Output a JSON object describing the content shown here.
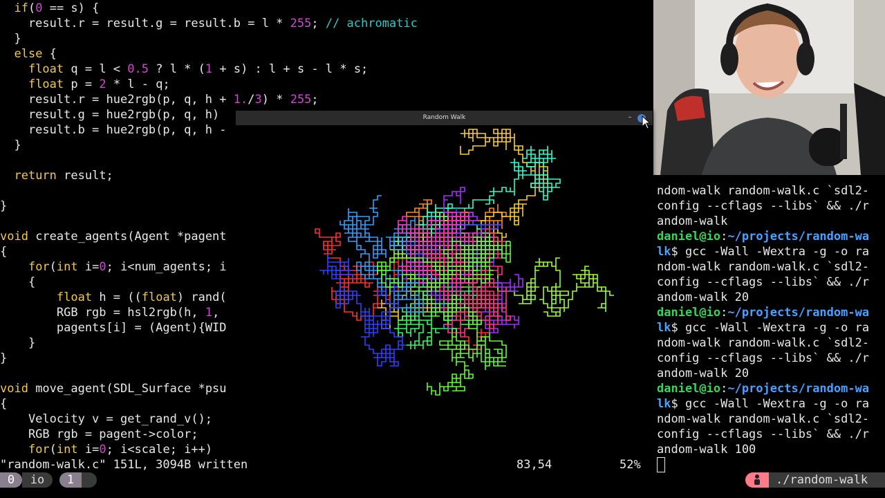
{
  "editor": {
    "lines": [
      [
        {
          "t": "  "
        },
        {
          "t": "if",
          "c": "kw"
        },
        {
          "t": "("
        },
        {
          "t": "0",
          "c": "num"
        },
        {
          "t": " == s) {"
        }
      ],
      [
        {
          "t": "    result.r = result.g = result.b = l * "
        },
        {
          "t": "255",
          "c": "num"
        },
        {
          "t": "; "
        },
        {
          "t": "// achromatic",
          "c": "cm"
        }
      ],
      [
        {
          "t": "  }"
        }
      ],
      [
        {
          "t": "  "
        },
        {
          "t": "else",
          "c": "kw"
        },
        {
          "t": " {"
        }
      ],
      [
        {
          "t": "    "
        },
        {
          "t": "float",
          "c": "kw"
        },
        {
          "t": " q = l < "
        },
        {
          "t": "0.5",
          "c": "num"
        },
        {
          "t": " ? l * ("
        },
        {
          "t": "1",
          "c": "num"
        },
        {
          "t": " + s) : l + s - l * s;"
        }
      ],
      [
        {
          "t": "    "
        },
        {
          "t": "float",
          "c": "kw"
        },
        {
          "t": " p = "
        },
        {
          "t": "2",
          "c": "num"
        },
        {
          "t": " * l - q;"
        }
      ],
      [
        {
          "t": "    result.r = hue2rgb(p, q, h + "
        },
        {
          "t": "1.",
          "c": "num"
        },
        {
          "t": "/"
        },
        {
          "t": "3",
          "c": "num"
        },
        {
          "t": ") * "
        },
        {
          "t": "255",
          "c": "num"
        },
        {
          "t": ";"
        }
      ],
      [
        {
          "t": "    result.g = hue2rgb(p, q, h) "
        }
      ],
      [
        {
          "t": "    result.b = hue2rgb(p, q, h -"
        }
      ],
      [
        {
          "t": "  }"
        }
      ],
      [
        {
          "t": ""
        }
      ],
      [
        {
          "t": "  "
        },
        {
          "t": "return",
          "c": "kw"
        },
        {
          "t": " result;"
        }
      ],
      [
        {
          "t": ""
        }
      ],
      [
        {
          "t": "}"
        }
      ],
      [
        {
          "t": ""
        }
      ],
      [
        {
          "t": "void",
          "c": "kw"
        },
        {
          "t": " create_agents(Agent *pagent"
        }
      ],
      [
        {
          "t": "{"
        }
      ],
      [
        {
          "t": "    "
        },
        {
          "t": "for",
          "c": "kw"
        },
        {
          "t": "("
        },
        {
          "t": "int",
          "c": "kw"
        },
        {
          "t": " i="
        },
        {
          "t": "0",
          "c": "num"
        },
        {
          "t": "; i<num_agents; i"
        }
      ],
      [
        {
          "t": "    {"
        }
      ],
      [
        {
          "t": "        "
        },
        {
          "t": "float",
          "c": "kw"
        },
        {
          "t": " h = (("
        },
        {
          "t": "float",
          "c": "kw"
        },
        {
          "t": ") rand("
        }
      ],
      [
        {
          "t": "        RGB rgb = hsl2rgb(h, "
        },
        {
          "t": "1",
          "c": "num"
        },
        {
          "t": ","
        }
      ],
      [
        {
          "t": "        pagents[i] = (Agent){WID"
        }
      ],
      [
        {
          "t": "    }"
        }
      ],
      [
        {
          "t": "}"
        }
      ],
      [
        {
          "t": ""
        }
      ],
      [
        {
          "t": "void",
          "c": "kw"
        },
        {
          "t": " move_agent(SDL_Surface *psu"
        }
      ],
      [
        {
          "t": "{"
        }
      ],
      [
        {
          "t": "    Velocity v = get_rand_v();"
        }
      ],
      [
        {
          "t": "    RGB rgb = pagent->color;"
        }
      ],
      [
        {
          "t": "    "
        },
        {
          "t": "for",
          "c": "kw"
        },
        {
          "t": "("
        },
        {
          "t": "int",
          "c": "kw"
        },
        {
          "t": " i="
        },
        {
          "t": "0",
          "c": "num"
        },
        {
          "t": "; i<scale; i++)"
        }
      ]
    ],
    "status_message": "\"random-walk.c\" 151L, 3094B written",
    "cursor_position": "83,54",
    "scroll_percent": "52%"
  },
  "terminal": {
    "lines": [
      [
        {
          "t": "ndom-walk random-walk.c `sdl2-"
        }
      ],
      [
        {
          "t": "config --cflags --libs` && ./r"
        }
      ],
      [
        {
          "t": "andom-walk"
        }
      ],
      [
        {
          "t": "daniel@io",
          "c": "user"
        },
        {
          "t": ":"
        },
        {
          "t": "~/projects/random-wa",
          "c": "path"
        }
      ],
      [
        {
          "t": "lk",
          "c": "path"
        },
        {
          "t": "$ gcc -Wall -Wextra -g -o ra"
        }
      ],
      [
        {
          "t": "ndom-walk random-walk.c `sdl2-"
        }
      ],
      [
        {
          "t": "config --cflags --libs` && ./r"
        }
      ],
      [
        {
          "t": "andom-walk 20"
        }
      ],
      [
        {
          "t": "daniel@io",
          "c": "user"
        },
        {
          "t": ":"
        },
        {
          "t": "~/projects/random-wa",
          "c": "path"
        }
      ],
      [
        {
          "t": "lk",
          "c": "path"
        },
        {
          "t": "$ gcc -Wall -Wextra -g -o ra"
        }
      ],
      [
        {
          "t": "ndom-walk random-walk.c `sdl2-"
        }
      ],
      [
        {
          "t": "config --cflags --libs` && ./r"
        }
      ],
      [
        {
          "t": "andom-walk 20"
        }
      ],
      [
        {
          "t": "daniel@io",
          "c": "user"
        },
        {
          "t": ":"
        },
        {
          "t": "~/projects/random-wa",
          "c": "path"
        }
      ],
      [
        {
          "t": "lk",
          "c": "path"
        },
        {
          "t": "$ gcc -Wall -Wextra -g -o ra"
        }
      ],
      [
        {
          "t": "ndom-walk random-walk.c `sdl2-"
        }
      ],
      [
        {
          "t": "config --cflags --libs` && ./r"
        }
      ],
      [
        {
          "t": "andom-walk 100"
        }
      ]
    ]
  },
  "tmux": {
    "window_index_left": "0",
    "session_name": "io",
    "window_index_active": "1",
    "window_title": "./random-walk",
    "icon": "person-icon"
  },
  "random_walk_window": {
    "title": "Random Walk",
    "minimize_label": "–",
    "close_icon": "close-icon"
  },
  "colors": {
    "keyword": "#f2c94c",
    "number": "#d048d0",
    "comment": "#2dc8c8",
    "prompt_user": "#3cd35a",
    "prompt_path": "#4aa0ff",
    "tmux_accent": "#8a7f8f",
    "tmux_icon_bg": "#ff7b8a"
  }
}
